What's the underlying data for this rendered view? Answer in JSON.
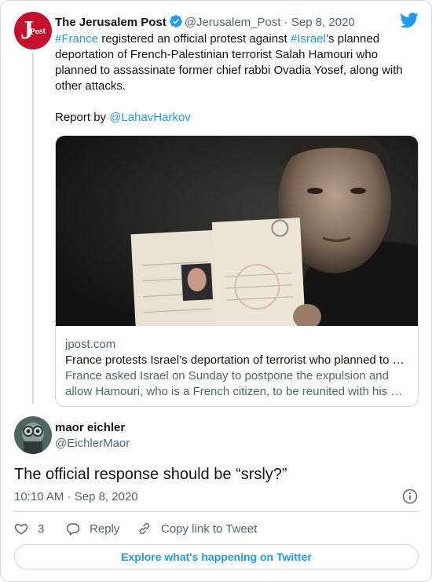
{
  "parent": {
    "name": "The Jerusalem Post",
    "handle": "@Jerusalem_Post",
    "date": "Sep 8, 2020",
    "avatar_letter": "J",
    "avatar_word": "Post",
    "text_hashtag_1": "#France",
    "text_part_1": " registered an official protest against ",
    "text_hashtag_2": "#Israel",
    "text_part_2": "’s planned deportation of French-Palestinian terrorist Salah Hamouri who planned to assassinate former chief rabbi Ovadia Yosef, along with other attacks.",
    "report_prefix": "Report by ",
    "report_mention": "@LahavHarkov",
    "card": {
      "domain": "jpost.com",
      "title": "France protests Israel’s deportation of terrorist who planned to …",
      "description_line_1": "France asked Israel on Sunday to postpone the expulsion and",
      "description_line_2": "allow Hamouri, who is a French citizen, to be reunited with his …"
    }
  },
  "reply": {
    "name": "maor eichler",
    "handle": "@EichlerMaor",
    "text": "The official response should be “srsly?”",
    "time": "10:10 AM",
    "separator": " · ",
    "date": "Sep 8, 2020"
  },
  "actions": {
    "like_count": "3",
    "reply_label": "Reply",
    "copy_label": "Copy link to Tweet"
  },
  "explore_label": "Explore what's happening on Twitter",
  "colors": {
    "accent": "#1d9bf0",
    "muted": "#536471",
    "border": "#cfd9de",
    "jpost_red": "#c8102e"
  },
  "icons": [
    "jpost-logo-icon",
    "verified-badge-icon",
    "twitter-bird-icon",
    "info-icon",
    "heart-icon",
    "reply-icon",
    "link-icon"
  ]
}
